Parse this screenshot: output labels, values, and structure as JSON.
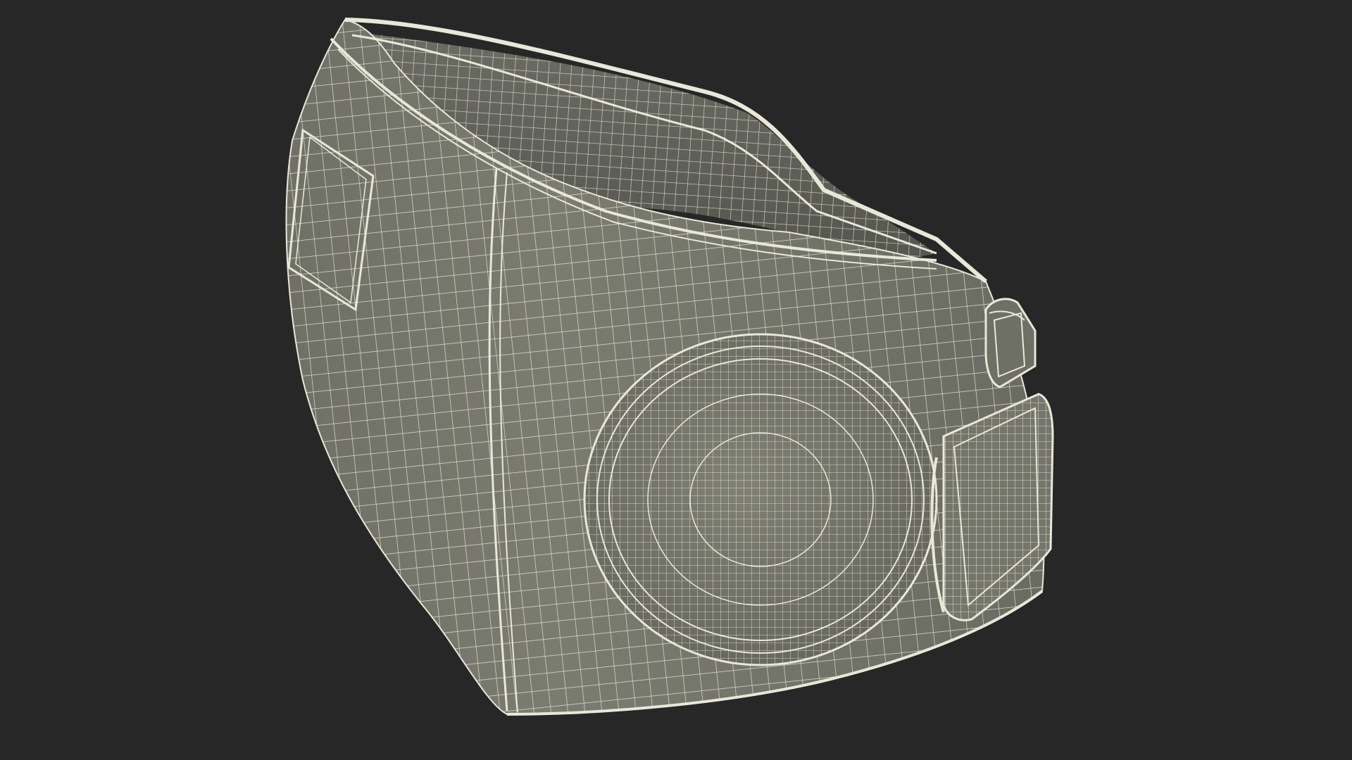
{
  "scene": {
    "background_color": "#272727",
    "object": "wireframe-3d-model-brace",
    "surface_color": "#7b7c70",
    "surface_shadow_color": "#5f6058",
    "wire_color": "#e9e8d8",
    "render_mode": "shaded-wireframe"
  }
}
